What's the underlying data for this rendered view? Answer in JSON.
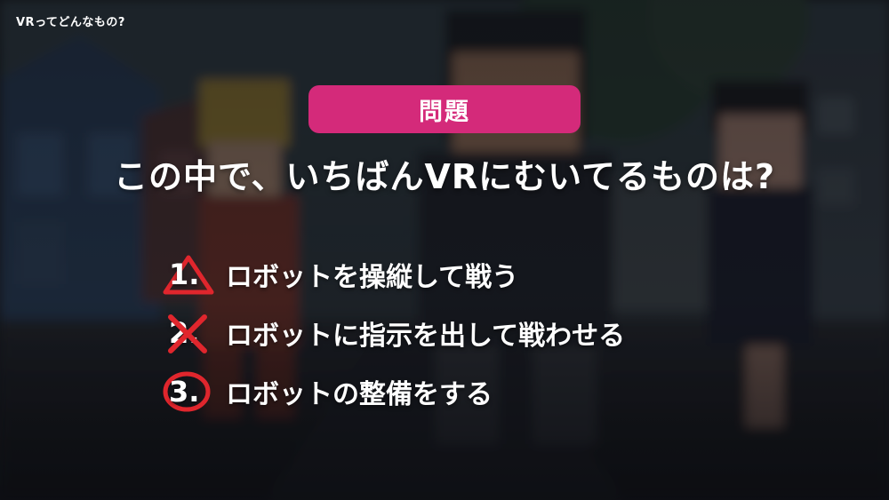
{
  "slide": {
    "section_label": "VRってどんなもの?",
    "badge_label": "問題",
    "question": "この中で、いちばんVRにむいてるものは?",
    "options": [
      {
        "number": "1.",
        "text": "ロボットを操縦して戦う",
        "mark": "triangle-icon"
      },
      {
        "number": "2.",
        "text": "ロボットに指示を出して戦わせる",
        "mark": "cross-icon"
      },
      {
        "number": "3.",
        "text": "ロボットの整備をする",
        "mark": "circle-icon"
      }
    ]
  },
  "colors": {
    "badge": "#d42a7a",
    "mark": "#e0262d",
    "overlay": "#1c2128"
  }
}
